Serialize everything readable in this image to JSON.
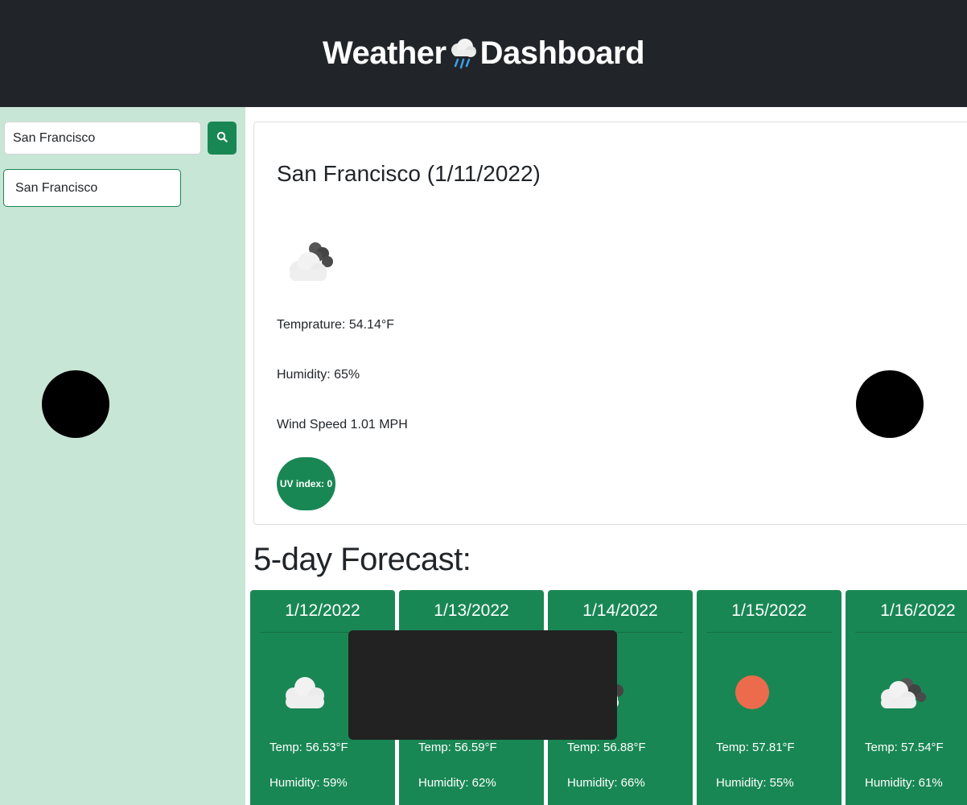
{
  "header": {
    "title_left": "Weather",
    "title_right": "Dashboard",
    "icon": "cloud-rain-icon"
  },
  "sidebar": {
    "search": {
      "value": "San Francisco",
      "button_icon": "search-icon"
    },
    "history": [
      "San Francisco"
    ]
  },
  "current": {
    "title": "San Francisco (1/11/2022)",
    "icon": "cloud-icon",
    "temperature": "Temprature: 54.14°F",
    "humidity": "Humidity: 65%",
    "wind": "Wind Speed 1.01 MPH",
    "uv": "UV index: 0"
  },
  "forecast": {
    "heading": "5-day Forecast:",
    "days": [
      {
        "date": "1/12/2022",
        "icon": "cloud-icon",
        "temp": "Temp: 56.53°F",
        "humidity": "Humidity: 59%"
      },
      {
        "date": "1/13/2022",
        "icon": "cloud-icon",
        "temp": "Temp: 56.59°F",
        "humidity": "Humidity: 62%"
      },
      {
        "date": "1/14/2022",
        "icon": "cloud-icon",
        "temp": "Temp: 56.88°F",
        "humidity": "Humidity: 66%"
      },
      {
        "date": "1/15/2022",
        "icon": "sun-icon",
        "temp": "Temp: 57.81°F",
        "humidity": "Humidity: 55%"
      },
      {
        "date": "1/16/2022",
        "icon": "cloud-icon",
        "temp": "Temp: 57.54°F",
        "humidity": "Humidity: 61%"
      }
    ]
  },
  "colors": {
    "header_bg": "#212529",
    "sidebar_bg": "#c8e6d6",
    "accent": "#198754",
    "sun": "#ec6b4d"
  }
}
